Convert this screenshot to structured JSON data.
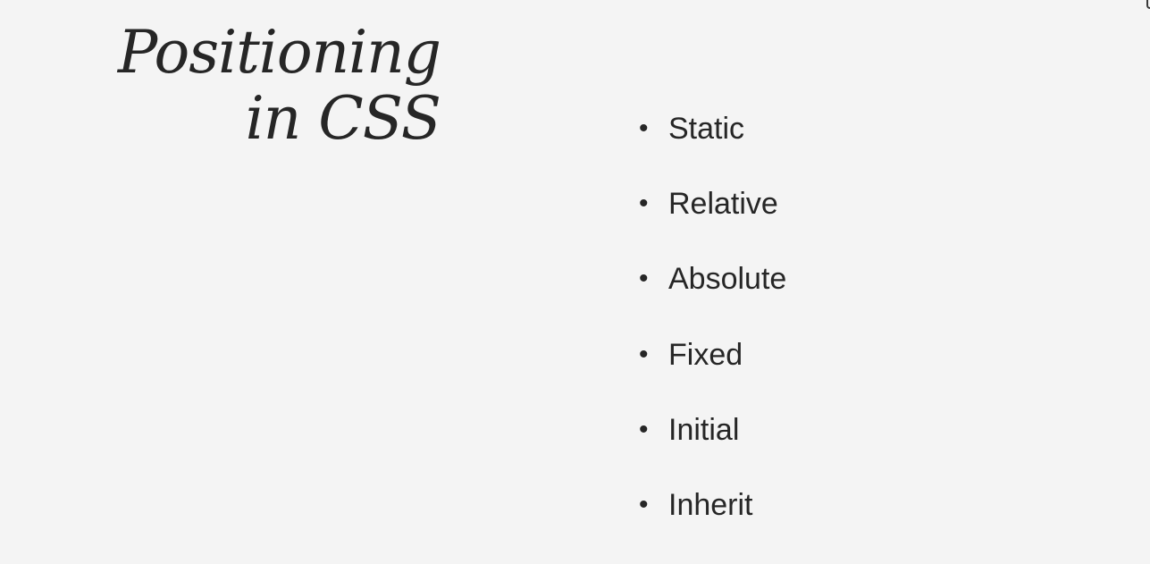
{
  "slide": {
    "title_lines": [
      "Positioning",
      "in CSS"
    ],
    "bullets": [
      "Static",
      "Relative",
      "Absolute",
      "Fixed",
      "Initial",
      "Inherit"
    ],
    "bullet_glyph": "•"
  },
  "colors": {
    "background": "#f4f4f4",
    "text": "#262626"
  }
}
